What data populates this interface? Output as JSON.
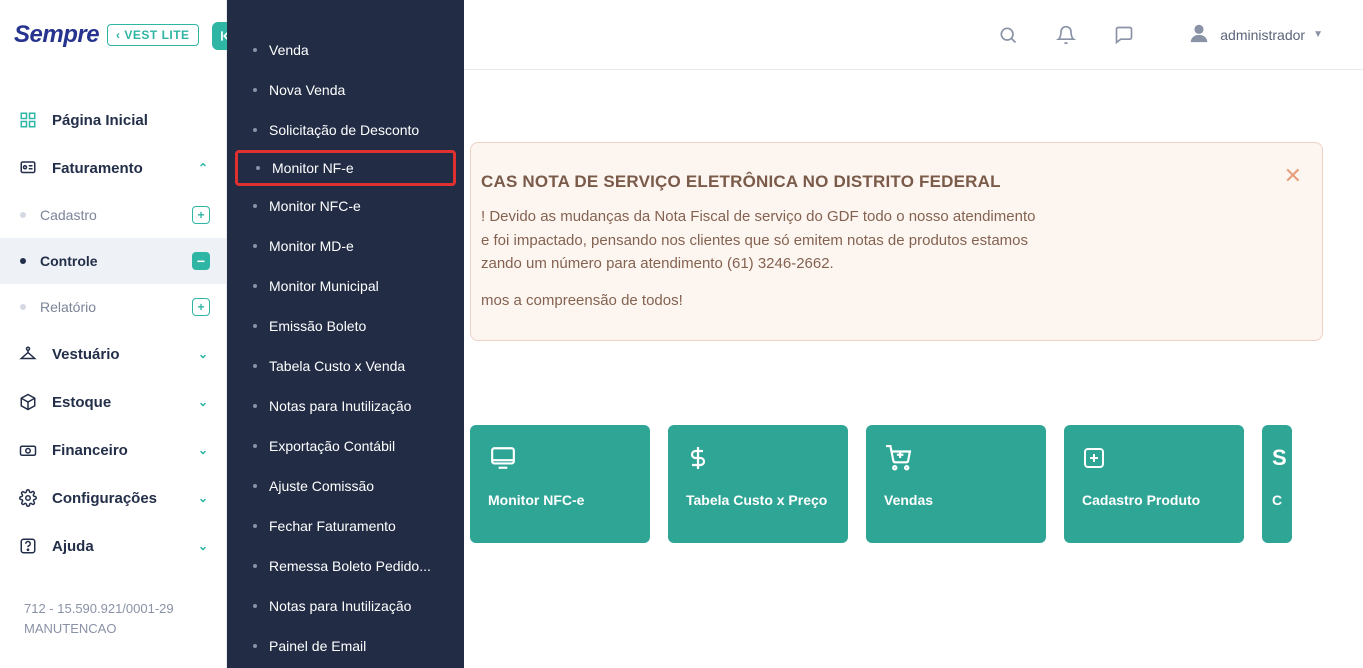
{
  "brand": {
    "name": "Sempre",
    "edition": "VEST LITE"
  },
  "header": {
    "title": "strador",
    "user": "administrador"
  },
  "sidebar": {
    "items": [
      {
        "label": "Página Inicial",
        "kind": "item"
      },
      {
        "label": "Faturamento",
        "kind": "expandable",
        "state": "open"
      },
      {
        "label": "Cadastro",
        "kind": "sub",
        "badge": "plus"
      },
      {
        "label": "Controle",
        "kind": "sub",
        "active": true,
        "badge": "minus"
      },
      {
        "label": "Relatório",
        "kind": "sub",
        "badge": "plus"
      },
      {
        "label": "Vestuário",
        "kind": "expandable"
      },
      {
        "label": "Estoque",
        "kind": "expandable"
      },
      {
        "label": "Financeiro",
        "kind": "expandable"
      },
      {
        "label": "Configurações",
        "kind": "expandable"
      },
      {
        "label": "Ajuda",
        "kind": "expandable"
      }
    ],
    "footer_l1": "712 - 15.590.921/0001-29",
    "footer_l2": "MANUTENCAO"
  },
  "flyout": {
    "items": [
      "Venda",
      "Nova Venda",
      "Solicitação de Desconto",
      "Monitor NF-e",
      "Monitor NFC-e",
      "Monitor MD-e",
      "Monitor Municipal",
      "Emissão Boleto",
      "Tabela Custo x Venda",
      "Notas para Inutilização",
      "Exportação Contábil",
      "Ajuste Comissão",
      "Fechar Faturamento",
      "Remessa Boleto Pedido...",
      "Notas para Inutilização",
      "Painel de Email"
    ],
    "highlighted_index": 3
  },
  "alert": {
    "title": "CAS NOTA DE SERVIÇO ELETRÔNICA NO DISTRITO FEDERAL",
    "line1": "! Devido as mudanças da Nota Fiscal de serviço do GDF todo o nosso atendimento",
    "line2": "e foi impactado, pensando nos clientes que só emitem notas de produtos estamos",
    "line3": "zando um número para atendimento (61) 3246-2662.",
    "line4": "mos a compreensão de todos!"
  },
  "tiles": [
    {
      "label": "Monitor NFC-e",
      "icon": "monitor"
    },
    {
      "label": "Tabela Custo x Preço",
      "icon": "dollar"
    },
    {
      "label": "Vendas",
      "icon": "cart"
    },
    {
      "label": "Cadastro Produto",
      "icon": "plus"
    },
    {
      "label": "C",
      "icon": "letter"
    }
  ]
}
